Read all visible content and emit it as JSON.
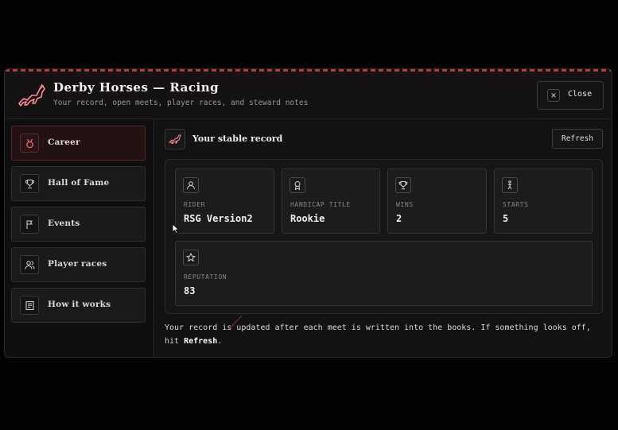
{
  "header": {
    "title": "Derby Horses — Racing",
    "subtitle": "Your record, open meets, player races, and steward notes",
    "close_label": "Close"
  },
  "sidebar": {
    "items": [
      {
        "label": "Career",
        "icon": "medal-icon",
        "active": true
      },
      {
        "label": "Hall of Fame",
        "icon": "trophy-icon",
        "active": false
      },
      {
        "label": "Events",
        "icon": "flag-icon",
        "active": false
      },
      {
        "label": "Player races",
        "icon": "users-icon",
        "active": false
      },
      {
        "label": "How it works",
        "icon": "book-icon",
        "active": false
      }
    ]
  },
  "main": {
    "section_title": "Your stable record",
    "refresh_label": "Refresh",
    "stats": [
      {
        "label": "RIDER",
        "value": "RSG Version2",
        "icon": "user-icon"
      },
      {
        "label": "HANDICAP TITLE",
        "value": "Rookie",
        "icon": "award-icon"
      },
      {
        "label": "WINS",
        "value": "2",
        "icon": "trophy-icon"
      },
      {
        "label": "STARTS",
        "value": "5",
        "icon": "runner-icon"
      },
      {
        "label": "REPUTATION",
        "value": "83",
        "icon": "star-icon"
      }
    ],
    "note_text": "Your record is updated after each meet is written into the books. If something looks off, hit ",
    "note_bold": "Refresh",
    "note_end": "."
  },
  "colors": {
    "accent": "#b8383f",
    "background": "#121212",
    "active_nav": "#221214"
  }
}
